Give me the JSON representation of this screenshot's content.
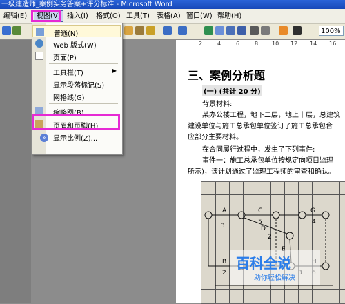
{
  "window": {
    "title": "一级建造师_案例实务答案+评分标准 - Microsoft Word"
  },
  "menubar": {
    "items": [
      {
        "label": "编辑(E)"
      },
      {
        "label": "视图(V)"
      },
      {
        "label": "插入(I)"
      },
      {
        "label": "格式(O)"
      },
      {
        "label": "工具(T)"
      },
      {
        "label": "表格(A)"
      },
      {
        "label": "窗口(W)"
      },
      {
        "label": "帮助(H)"
      }
    ]
  },
  "toolbar": {
    "zoom": "100%"
  },
  "view_menu": {
    "items": [
      {
        "label": "普通(N)",
        "icon": "normal-view-icon"
      },
      {
        "label": "Web 版式(W)",
        "icon": "web-layout-icon"
      },
      {
        "label": "页面(P)",
        "icon": "page-layout-icon"
      },
      {
        "label": "工具栏(T)",
        "has_submenu": true
      },
      {
        "label": "显示段落标记(S)"
      },
      {
        "label": "网格线(G)"
      },
      {
        "label": "缩略图(B)",
        "icon": "thumbnail-icon"
      },
      {
        "label": "页眉和页脚(H)",
        "icon": "header-footer-icon"
      },
      {
        "label": "显示比例(Z)..."
      }
    ]
  },
  "ruler": {
    "numbers": [
      "2",
      "4",
      "6",
      "8",
      "10",
      "12",
      "14",
      "16"
    ]
  },
  "document": {
    "heading": "三、案例分析题",
    "subheading": "(一) (共计 20 分)",
    "line1": "背景材料:",
    "line2": "某办公楼工程，地下二层，地上十层，总建筑",
    "line3": "建设单位与施工总承包单位签订了施工总承包合",
    "line4": "应部分主要材料。",
    "line5": "在合同履行过程中，发生了下列事件:",
    "line6": "事件一：施工总承包单位按规定向项目监理",
    "line7": "所示)，该计划通过了监理工程师的审查和确认。"
  },
  "figure": {
    "labels": [
      "A",
      "B",
      "C",
      "D",
      "E",
      "G",
      "H",
      "3",
      "5",
      "4",
      "2",
      "2",
      "6",
      "3"
    ]
  },
  "watermark": {
    "main": "百科全说",
    "sub": "助你轻松解决"
  }
}
